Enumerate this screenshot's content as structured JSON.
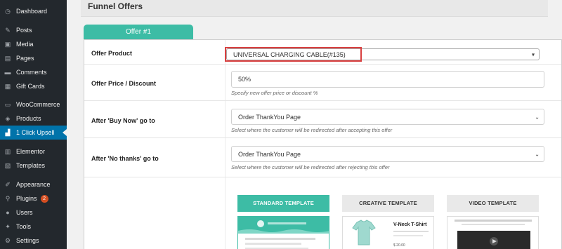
{
  "sidebar": {
    "items": [
      {
        "label": "Dashboard",
        "icon": "dashboard-icon",
        "glyph": "◷"
      },
      {
        "label": "Posts",
        "icon": "pin-icon",
        "glyph": "✎"
      },
      {
        "label": "Media",
        "icon": "media-icon",
        "glyph": "▣"
      },
      {
        "label": "Pages",
        "icon": "pages-icon",
        "glyph": "▤"
      },
      {
        "label": "Comments",
        "icon": "comments-icon",
        "glyph": "▬"
      },
      {
        "label": "Gift Cards",
        "icon": "gift-card-icon",
        "glyph": "▦"
      },
      {
        "label": "WooCommerce",
        "icon": "woocommerce-icon",
        "glyph": "▭"
      },
      {
        "label": "Products",
        "icon": "products-icon",
        "glyph": "◈"
      },
      {
        "label": "1 Click Upsell",
        "icon": "chart-icon",
        "glyph": "▟"
      },
      {
        "label": "Elementor",
        "icon": "elementor-icon",
        "glyph": "▥"
      },
      {
        "label": "Templates",
        "icon": "templates-icon",
        "glyph": "▧"
      },
      {
        "label": "Appearance",
        "icon": "brush-icon",
        "glyph": "✐"
      },
      {
        "label": "Plugins",
        "icon": "plugin-icon",
        "glyph": "⚲",
        "badge": "2"
      },
      {
        "label": "Users",
        "icon": "user-icon",
        "glyph": "●"
      },
      {
        "label": "Tools",
        "icon": "wrench-icon",
        "glyph": "✦"
      },
      {
        "label": "Settings",
        "icon": "settings-icon",
        "glyph": "⚙"
      }
    ],
    "active": "1 Click Upsell"
  },
  "funnel": {
    "title": "Funnel Offers",
    "tab_label": "Offer #1"
  },
  "offer": {
    "product_label": "Offer Product",
    "product_value": "UNIVERSAL CHARGING CABLE(#135)",
    "price_label": "Offer Price / Discount",
    "price_value": "50%",
    "price_help": "Specify new offer price or discount %",
    "buy_now_label": "After 'Buy Now' go to",
    "buy_now_value": "Order ThankYou Page",
    "buy_now_help": "Select where the customer will be redirected after accepting this offer",
    "no_thanks_label": "After 'No thanks' go to",
    "no_thanks_value": "Order ThankYou Page",
    "no_thanks_help": "Select where the customer will be redirected after rejecting this offer"
  },
  "templates": {
    "standard": "STANDARD TEMPLATE",
    "creative": "CREATIVE TEMPLATE",
    "video": "VIDEO TEMPLATE",
    "creative_preview_title": "V-Neck T-Shirt",
    "creative_preview_price": "$ 20.00"
  },
  "colors": {
    "accent": "#3dbca5",
    "sidebar_bg": "#23282d",
    "active_menu": "#0073aa",
    "highlight": "#d94040"
  }
}
